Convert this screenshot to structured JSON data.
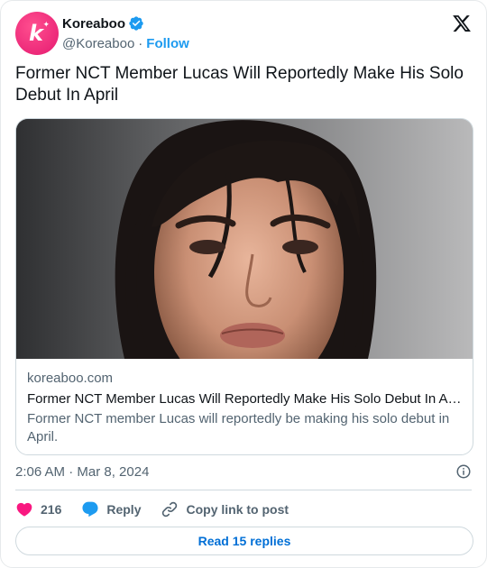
{
  "author": {
    "display_name": "Koreaboo",
    "handle": "@Koreaboo",
    "follow_label": "Follow",
    "avatar_letter": "k",
    "avatar_color": "#e91e73",
    "verified": true,
    "verified_color": "#1d9bf0"
  },
  "tweet": {
    "text": "Former NCT Member Lucas Will Reportedly Make His Solo Debut In April"
  },
  "link_card": {
    "domain": "koreaboo.com",
    "title": "Former NCT Member Lucas Will Reportedly Make His Solo Debut In Ap...",
    "description": "Former NCT member Lucas will reportedly be making his solo debut in April."
  },
  "timestamp": "2:06 AM · Mar 8, 2024",
  "actions": {
    "like_count": "216",
    "like_color": "#f91880",
    "reply_label": "Reply",
    "reply_color": "#1d9bf0",
    "copy_label": "Copy link to post"
  },
  "read_replies_label": "Read 15 replies",
  "icons": [
    "verified-badge-icon",
    "x-logo-icon",
    "info-icon",
    "heart-icon",
    "speech-bubble-icon",
    "link-icon"
  ]
}
